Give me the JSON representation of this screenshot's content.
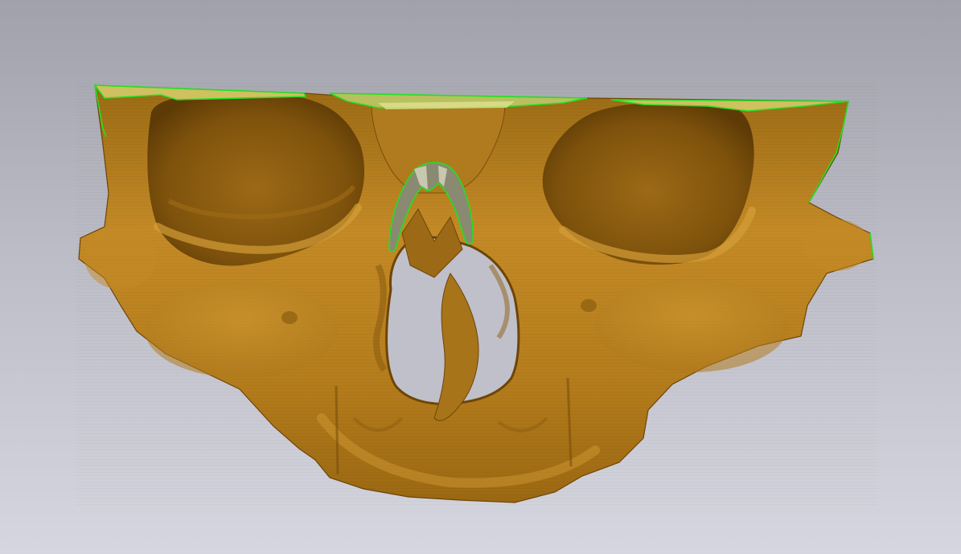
{
  "viewer": {
    "model_label": "",
    "colors": {
      "bone": "#b8801c",
      "bone_light": "#d09a34",
      "bone_dark": "#6e4508",
      "cut_outline": "#22e022",
      "background_top": "#a1a1ab",
      "background_bottom": "#d6d6e0"
    }
  }
}
